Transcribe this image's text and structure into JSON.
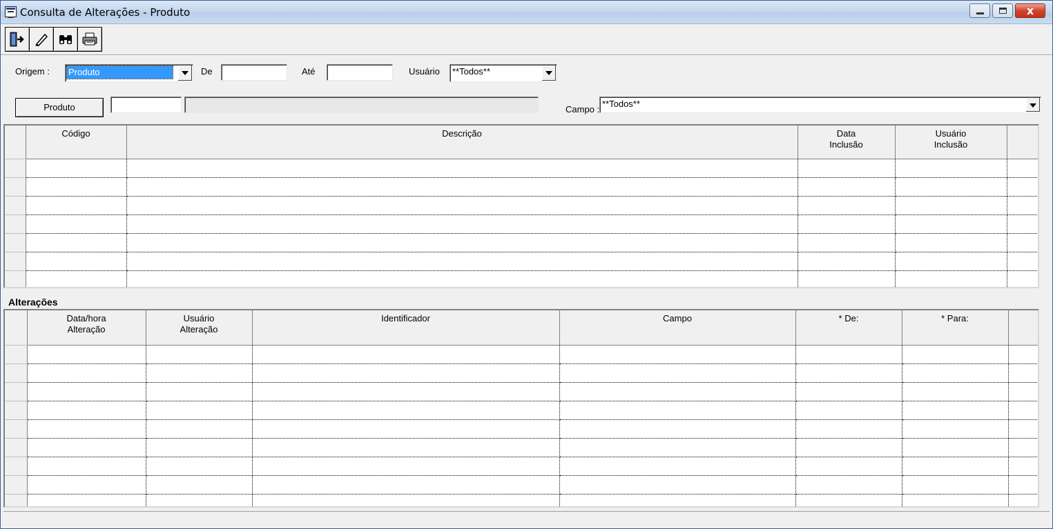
{
  "window": {
    "title": "Consulta de Alterações - Produto",
    "close_glyph": "x"
  },
  "toolbar": {
    "buttons": [
      {
        "name": "exit-door-icon"
      },
      {
        "name": "eraser-icon"
      },
      {
        "name": "binoculars-icon"
      },
      {
        "name": "printer-icon"
      }
    ]
  },
  "filters": {
    "origem_label": "Origem :",
    "origem_value": "Produto",
    "de_label": "De",
    "de_value": "",
    "ate_label": "Até",
    "ate_value": "",
    "usuario_label": "Usuário",
    "usuario_value": "**Todos**",
    "produto_button": "Produto",
    "produto_code": "",
    "produto_desc": "",
    "campo_label": "Campo :",
    "campo_value": "**Todos**"
  },
  "grid1": {
    "columns": [
      "Código",
      "Descrição",
      "Data\nInclusão",
      "Usuário\nInclusão"
    ],
    "row_count": 7
  },
  "grid2": {
    "section_title": "Alterações",
    "columns": [
      "Data/hora\nAlteração",
      "Usuário\nAlteração",
      "Identificador",
      "Campo",
      "* De:",
      "* Para:"
    ],
    "row_count": 9
  },
  "colors": {
    "selection": "#3399ff",
    "face": "#f0f0f0",
    "title_gradient_top": "#dbe8f6",
    "close_red": "#c23418"
  }
}
